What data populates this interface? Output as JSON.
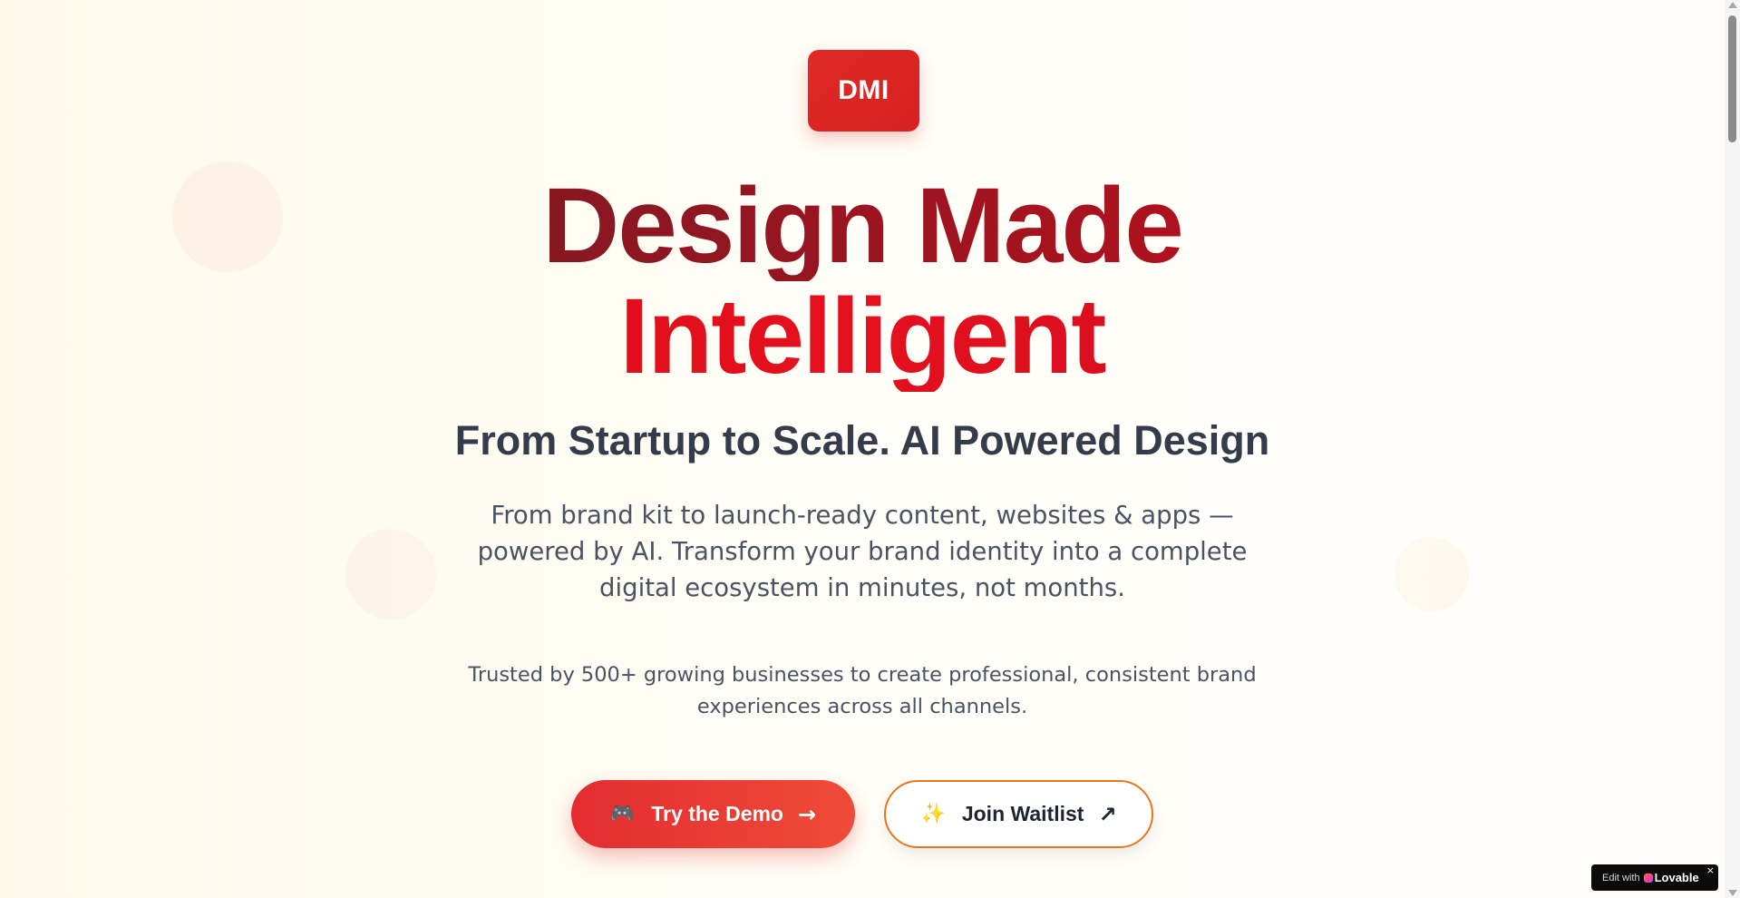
{
  "logo": {
    "text": "DMI"
  },
  "hero": {
    "headline_line1": "Design Made",
    "headline_line2": "Intelligent",
    "subheadline": "From Startup to Scale. AI Powered Design",
    "description": "From brand kit to launch-ready content, websites & apps — powered by AI. Transform your brand identity into a complete digital ecosystem in minutes, not months.",
    "trusted_text": "Trusted by 500+ growing businesses to create professional, consistent brand experiences across all channels."
  },
  "cta": {
    "demo_label": "Try the Demo",
    "demo_icon": "🎮",
    "demo_arrow": "→",
    "waitlist_label": "Join Waitlist",
    "waitlist_icon": "✨",
    "waitlist_arrow": "↗"
  },
  "badge": {
    "prefix": "Edit with",
    "brand": "Lovable",
    "close": "×"
  },
  "colors": {
    "brand_red": "#e02a26",
    "headline_dark": "#6d1a22",
    "headline_red": "#dc0a18",
    "text_dark": "#343c4c",
    "text_body": "#4b5363",
    "waitlist_border": "#e8761c"
  }
}
